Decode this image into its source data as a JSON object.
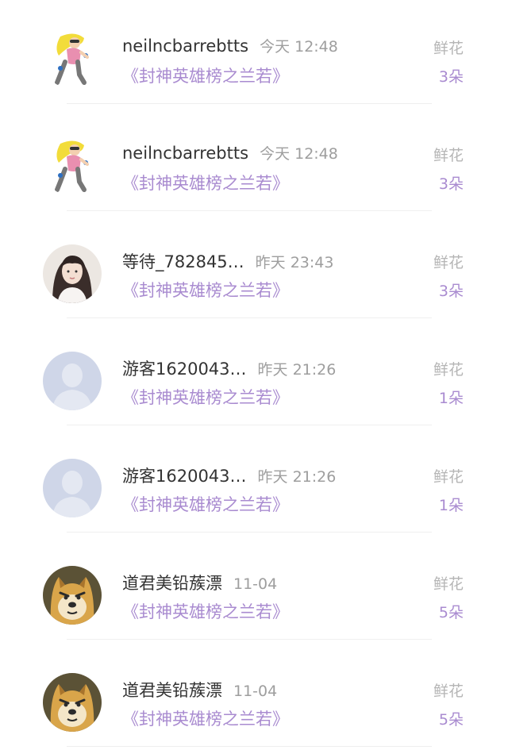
{
  "gift_records": [
    {
      "avatar": "cartoon-girl-avatar",
      "name": "neilncbarrebtts",
      "time": "今天 12:48",
      "book": "《封神英雄榜之兰若》",
      "gift_label": "鲜花",
      "gift_count": "3朵"
    },
    {
      "avatar": "cartoon-girl-avatar",
      "name": "neilncbarrebtts",
      "time": "今天 12:48",
      "book": "《封神英雄榜之兰若》",
      "gift_label": "鲜花",
      "gift_count": "3朵"
    },
    {
      "avatar": "photo-girl-avatar",
      "name": "等待_782845…",
      "time": "昨天 23:43",
      "book": "《封神英雄榜之兰若》",
      "gift_label": "鲜花",
      "gift_count": "3朵"
    },
    {
      "avatar": "default-user-avatar",
      "name": "游客1620043…",
      "time": "昨天 21:26",
      "book": "《封神英雄榜之兰若》",
      "gift_label": "鲜花",
      "gift_count": "1朵"
    },
    {
      "avatar": "default-user-avatar",
      "name": "游客1620043…",
      "time": "昨天 21:26",
      "book": "《封神英雄榜之兰若》",
      "gift_label": "鲜花",
      "gift_count": "1朵"
    },
    {
      "avatar": "doge-avatar",
      "name": "道君美铅蔟漂",
      "time": "11-04",
      "book": "《封神英雄榜之兰若》",
      "gift_label": "鲜花",
      "gift_count": "5朵"
    },
    {
      "avatar": "doge-avatar",
      "name": "道君美铅蔟漂",
      "time": "11-04",
      "book": "《封神英雄榜之兰若》",
      "gift_label": "鲜花",
      "gift_count": "5朵"
    }
  ],
  "colors": {
    "accent_purple": "#a98bd0",
    "name_text": "#333333",
    "time_text": "#9e9e9e",
    "gift_label_text": "#b5b5b5",
    "default_avatar_bg": "#cfd6e8"
  }
}
